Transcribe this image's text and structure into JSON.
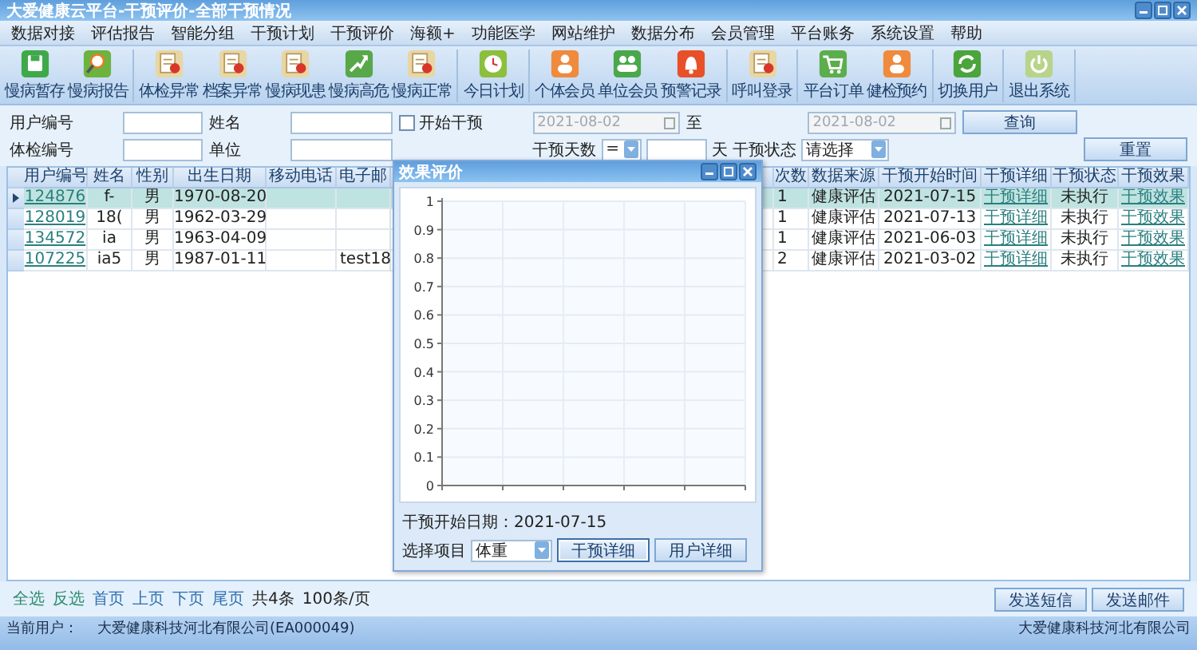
{
  "window": {
    "title": "大爱健康云平台-干预评价-全部干预情况"
  },
  "menu": [
    "数据对接",
    "评估报告",
    "智能分组",
    "干预计划",
    "干预评价",
    "海额+",
    "功能医学",
    "网站维护",
    "数据分布",
    "会员管理",
    "平台账务",
    "系统设置",
    "帮助"
  ],
  "toolbar": {
    "groups": [
      [
        "慢病暂存",
        "慢病报告"
      ],
      [
        "体检异常",
        "档案异常",
        "慢病现患",
        "慢病高危",
        "慢病正常"
      ],
      [
        "今日计划"
      ],
      [
        "个体会员",
        "单位会员",
        "预警记录"
      ],
      [
        "呼叫登录"
      ],
      [
        "平台订单",
        "健检预约"
      ],
      [
        "切换用户"
      ],
      [
        "退出系统"
      ]
    ]
  },
  "search": {
    "user_id": {
      "label": "用户编号"
    },
    "name": {
      "label": "姓名"
    },
    "start_intervention": {
      "label": "开始干预",
      "checked": false
    },
    "date_from": {
      "value": "2021-08-02",
      "disabled": true
    },
    "date_to_label": "至",
    "date_to": {
      "value": "2021-08-02",
      "disabled": true
    },
    "query_button": "查询",
    "exam_id": {
      "label": "体检编号"
    },
    "unit": {
      "label": "单位"
    },
    "days": {
      "label": "干预天数",
      "operator": "=",
      "unit": "天"
    },
    "status": {
      "label": "干预状态",
      "value": "请选择"
    },
    "reset_button": "重置"
  },
  "table": {
    "columns_left": [
      "用户编号",
      "姓名",
      "性别",
      "出生日期",
      "移动电话",
      "电子邮"
    ],
    "columns_right": [
      "次数",
      "数据来源",
      "干预开始时间",
      "干预详细",
      "干预状态",
      "干预效果"
    ],
    "rows": [
      {
        "selected": true,
        "user_id": "124876",
        "name": "f-",
        "gender": "男",
        "birth_date": "1970-08-20",
        "count": "1",
        "source": "健康评估",
        "start_time": "2021-07-15",
        "detail": "干预详细",
        "status": "未执行",
        "effect": "干预效果"
      },
      {
        "selected": false,
        "user_id": "128019",
        "name": "18(",
        "gender": "男",
        "birth_date": "1962-03-29",
        "count": "1",
        "source": "健康评估",
        "start_time": "2021-07-13",
        "detail": "干预详细",
        "status": "未执行",
        "effect": "干预效果"
      },
      {
        "selected": false,
        "user_id": "134572",
        "name": "ia",
        "gender": "男",
        "birth_date": "1963-04-09",
        "count": "1",
        "source": "健康评估",
        "start_time": "2021-06-03",
        "detail": "干预详细",
        "status": "未执行",
        "effect": "干预效果"
      },
      {
        "selected": false,
        "user_id": "107225",
        "name": "ia5",
        "gender": "男",
        "birth_date": "1987-01-11",
        "email": "test18",
        "count": "2",
        "source": "健康评估",
        "start_time": "2021-03-02",
        "detail": "干预详细",
        "status": "未执行",
        "effect": "干预效果"
      }
    ]
  },
  "dialog": {
    "title": "效果评价",
    "chart_data": {
      "type": "line",
      "categories": [
        null,
        null,
        null,
        null,
        null
      ],
      "grid": true,
      "ylim": [
        0,
        1
      ],
      "yticks": [
        {
          "value": 0,
          "label": "0"
        },
        {
          "value": 0.1,
          "label": "0.1"
        },
        {
          "value": 0.2,
          "label": "0.2"
        },
        {
          "value": 0.3,
          "label": "0.3"
        },
        {
          "value": 0.4,
          "label": "0.4"
        },
        {
          "value": 0.5,
          "label": "0.5"
        },
        {
          "value": 0.6,
          "label": "0.6"
        },
        {
          "value": 0.7,
          "label": "0.7"
        },
        {
          "value": 0.8,
          "label": "0.8"
        },
        {
          "value": 0.9,
          "label": "0.9"
        },
        {
          "value": 1,
          "label": "1"
        }
      ]
    },
    "start_date": "干预开始日期：2021-07-15",
    "item_label": "选择项目",
    "item_value": "体重",
    "buttons": [
      {
        "label": "干预详细",
        "selected": true
      },
      {
        "label": "用户详细",
        "selected": false
      }
    ]
  },
  "pager": {
    "links": [
      "全选",
      "反选",
      "首页",
      "上页",
      "下页",
      "尾页"
    ],
    "total": "共4条",
    "page_size": "100条/页"
  },
  "actions": [
    "发送短信",
    "发送邮件"
  ],
  "status_bar": {
    "label": "当前用户：",
    "user": "大爱健康科技河北有限公司(EA000049)",
    "company": "大爱健康科技河北有限公司"
  }
}
